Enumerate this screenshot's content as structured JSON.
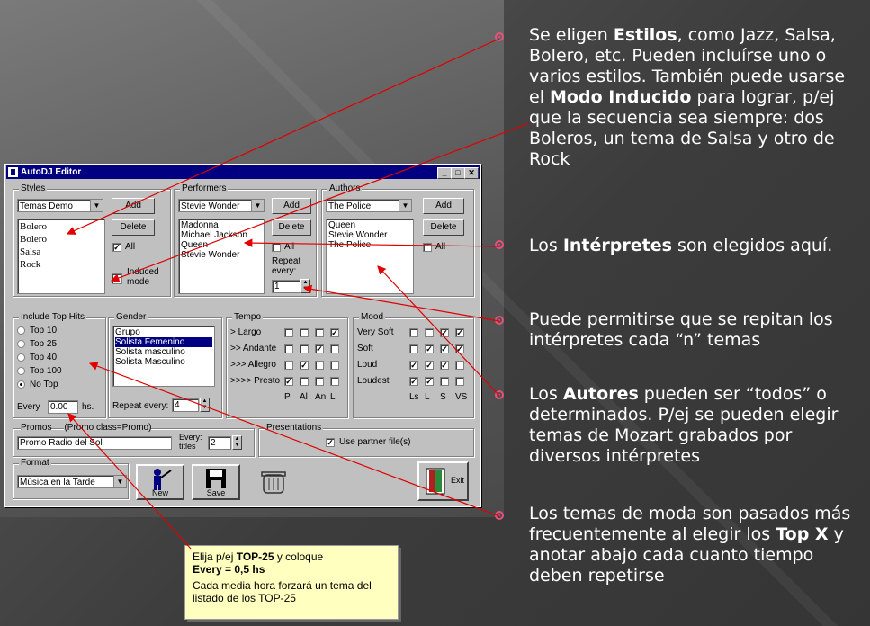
{
  "window": {
    "title": "AutoDJ Editor",
    "min": "_",
    "max": "□",
    "close": "✕"
  },
  "styles": {
    "label": "Styles",
    "combo": "Temas Demo",
    "add": "Add",
    "delete": "Delete",
    "items": [
      "Bolero",
      "Bolero",
      "Salsa",
      "Rock"
    ],
    "all_label": "All",
    "all_checked": true,
    "induced_label": "Induced mode"
  },
  "performers": {
    "label": "Performers",
    "combo": "Stevie Wonder",
    "add": "Add",
    "delete": "Delete",
    "items": [
      "Madonna",
      "Michael Jackson",
      "Queen",
      "Stevie Wonder"
    ],
    "all_label": "All",
    "repeat_label": "Repeat every:",
    "repeat_value": "1"
  },
  "authors": {
    "label": "Authors",
    "combo": "The Police",
    "add": "Add",
    "delete": "Delete",
    "items": [
      "Queen",
      "Stevie Wonder",
      "The Police"
    ],
    "all_label": "All"
  },
  "tophits": {
    "label": "Include Top Hits",
    "options": [
      "Top 10",
      "Top 25",
      "Top 40",
      "Top 100",
      "No Top"
    ],
    "selected": "No Top",
    "every_label": "Every",
    "every_value": "0.00",
    "hs": "hs."
  },
  "gender": {
    "label": "Gender",
    "items": [
      "Grupo",
      "Solista Femenino",
      "Solista masculino",
      "Solista Masculino"
    ],
    "selected": "Solista Femenino",
    "repeat_label": "Repeat every:",
    "repeat_value": "4"
  },
  "tempo": {
    "label": "Tempo",
    "rows": [
      "> Largo",
      ">> Andante",
      ">>> Allegro",
      ">>>> Presto"
    ],
    "cols": [
      "P",
      "Al",
      "An",
      "L"
    ],
    "checks": [
      [
        false,
        false,
        false,
        true
      ],
      [
        false,
        false,
        true,
        false
      ],
      [
        false,
        true,
        false,
        false
      ],
      [
        true,
        false,
        false,
        false
      ]
    ]
  },
  "mood": {
    "label": "Mood",
    "rows": [
      "Very Soft",
      "Soft",
      "Loud",
      "Loudest"
    ],
    "cols": [
      "Ls",
      "L",
      "S",
      "VS"
    ],
    "checks": [
      [
        false,
        false,
        true,
        true
      ],
      [
        false,
        true,
        true,
        true
      ],
      [
        true,
        true,
        true,
        false
      ],
      [
        true,
        true,
        false,
        false
      ]
    ]
  },
  "promos": {
    "label": "Promos",
    "class_label": "(Promo class=Promo)",
    "value": "Promo Radio del Sol",
    "every_label": "Every: titles",
    "every_value": "2"
  },
  "presentations": {
    "label": "Presentations",
    "partner_label": "Use partner file(s)"
  },
  "format": {
    "label": "Format",
    "combo": "Música en la Tarde"
  },
  "buttons": {
    "new": "New",
    "save": "Save",
    "exit": "Exit"
  },
  "bullets": [
    {
      "parts": [
        [
          "Se eligen ",
          false
        ],
        [
          "Estilos",
          true
        ],
        [
          ", como Jazz, Salsa, Bolero, etc. Pueden incluírse uno o varios estilos. También puede usarse el ",
          false
        ],
        [
          "Modo Inducido",
          true
        ],
        [
          " para lograr, p/ej  que la secuencia sea siempre: dos Boleros, un tema de Salsa y otro de Rock",
          false
        ]
      ]
    },
    {
      "parts": [
        [
          "Los ",
          false
        ],
        [
          "Intérpretes",
          true
        ],
        [
          " son elegidos aquí.",
          false
        ]
      ]
    },
    {
      "parts": [
        [
          "Puede permitirse que se repitan los intérpretes cada “n” temas",
          false
        ]
      ]
    },
    {
      "parts": [
        [
          "Los ",
          false
        ],
        [
          "Autores",
          true
        ],
        [
          " pueden ser “todos” o determinados. P/ej se pueden elegir temas de Mozart grabados por diversos intérpretes",
          false
        ]
      ]
    },
    {
      "parts": [
        [
          "Los temas de moda son pasados más frecuentemente al elegir los ",
          false
        ],
        [
          "Top X",
          true
        ],
        [
          " y anotar abajo cada cuanto tiempo deben repetirse",
          false
        ]
      ]
    }
  ],
  "note": {
    "line1_pre": "Elija p/ej ",
    "line1_bold": "TOP-25",
    "line1_post": " y coloque",
    "line2": "Every = 0,5 hs",
    "line3": "Cada media hora forzará un tema del listado de los TOP-25"
  },
  "colors": {
    "accent": "#e8507a",
    "arrow": "#e00000",
    "titlebar": "#000080"
  }
}
